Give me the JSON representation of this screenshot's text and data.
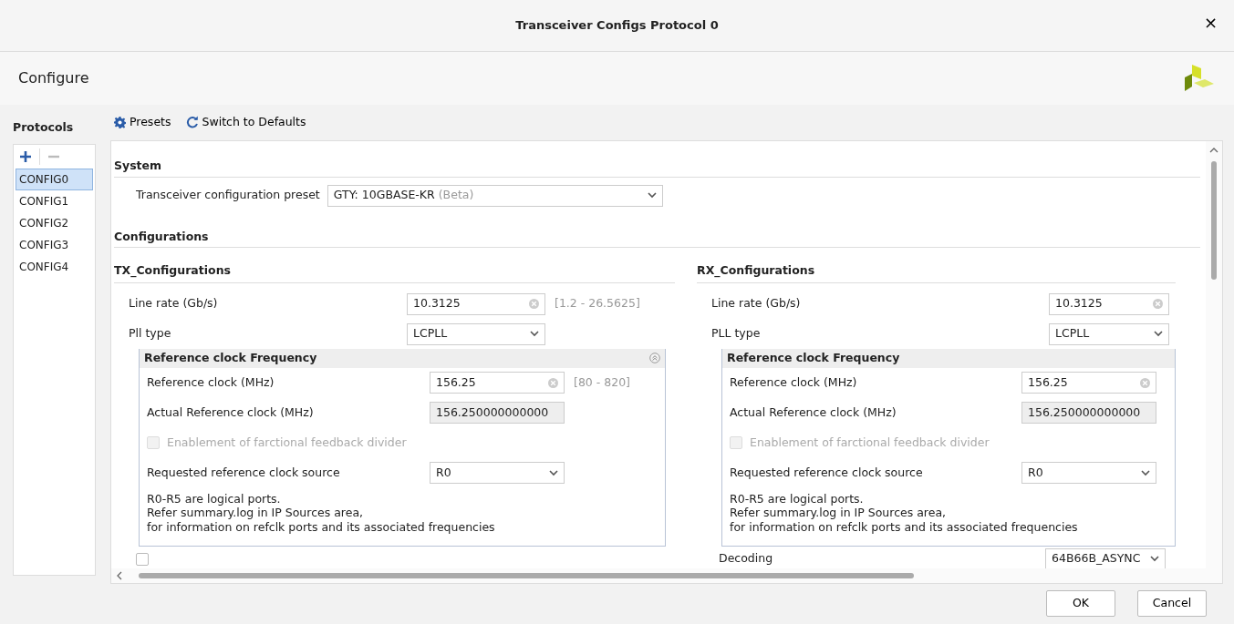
{
  "window": {
    "title": "Transceiver Configs Protocol 0",
    "close": "×"
  },
  "header": {
    "title": "Configure"
  },
  "protocols": {
    "title": "Protocols",
    "items": [
      {
        "label": "CONFIG0",
        "selected": true
      },
      {
        "label": "CONFIG1",
        "selected": false
      },
      {
        "label": "CONFIG2",
        "selected": false
      },
      {
        "label": "CONFIG3",
        "selected": false
      },
      {
        "label": "CONFIG4",
        "selected": false
      }
    ]
  },
  "toolbar": [
    {
      "kind": "gear",
      "label": "Presets"
    },
    {
      "kind": "refresh",
      "label": "Switch to Defaults"
    }
  ],
  "system": {
    "title": "System",
    "preset_label": "Transceiver configuration preset",
    "preset_value": "GTY: 10GBASE-KR",
    "preset_suffix": "(Beta)"
  },
  "configurations": {
    "title": "Configurations",
    "columns": [
      {
        "title": "TX_Configurations",
        "fields": [
          {
            "kind": "text",
            "label": "Line rate (Gb/s)",
            "value": "10.3125",
            "range": "[1.2 - 26.5625]"
          },
          {
            "kind": "select",
            "label": "Pll type",
            "value": "LCPLL"
          }
        ],
        "group": {
          "title": "Reference clock Frequency",
          "collapse_icon": true,
          "fields": [
            {
              "kind": "text",
              "label": "Reference clock (MHz)",
              "value": "156.25",
              "range": "[80 - 820]"
            },
            {
              "kind": "readonly",
              "label": "Actual Reference clock (MHz)",
              "value": "156.250000000000"
            },
            {
              "kind": "checkbox",
              "label": "Enablement of farctional feedback divider",
              "checked": false,
              "disabled": true
            },
            {
              "kind": "select",
              "label": "Requested reference clock source",
              "value": "R0"
            },
            {
              "kind": "note",
              "text": "R0-R5 are logical ports.\nRefer summary.log in IP Sources area,\nfor information on refclk ports and its associated frequencies"
            }
          ]
        },
        "after": [
          {
            "kind": "checkbox",
            "checked": false,
            "disabled": false
          }
        ]
      },
      {
        "title": "RX_Configurations",
        "fields": [
          {
            "kind": "text",
            "label": "Line rate (Gb/s)",
            "value": "10.3125"
          },
          {
            "kind": "select",
            "label": "PLL type",
            "value": "LCPLL"
          }
        ],
        "group": {
          "title": "Reference clock Frequency",
          "collapse_icon": false,
          "fields": [
            {
              "kind": "text",
              "label": "Reference clock (MHz)",
              "value": "156.25"
            },
            {
              "kind": "readonly",
              "label": "Actual Reference clock (MHz)",
              "value": "156.250000000000"
            },
            {
              "kind": "checkbox",
              "label": "Enablement of farctional feedback divider",
              "checked": false,
              "disabled": true
            },
            {
              "kind": "select",
              "label": "Requested reference clock source",
              "value": "R0"
            },
            {
              "kind": "note",
              "text": "R0-R5 are logical ports.\nRefer summary.log in IP Sources area,\nfor information on refclk ports and its associated frequencies"
            }
          ]
        },
        "after": [
          {
            "kind": "select",
            "label": "Decoding",
            "value": "64B66B_ASYNC"
          }
        ]
      }
    ]
  },
  "buttons": [
    {
      "label": "OK"
    },
    {
      "label": "Cancel"
    }
  ]
}
